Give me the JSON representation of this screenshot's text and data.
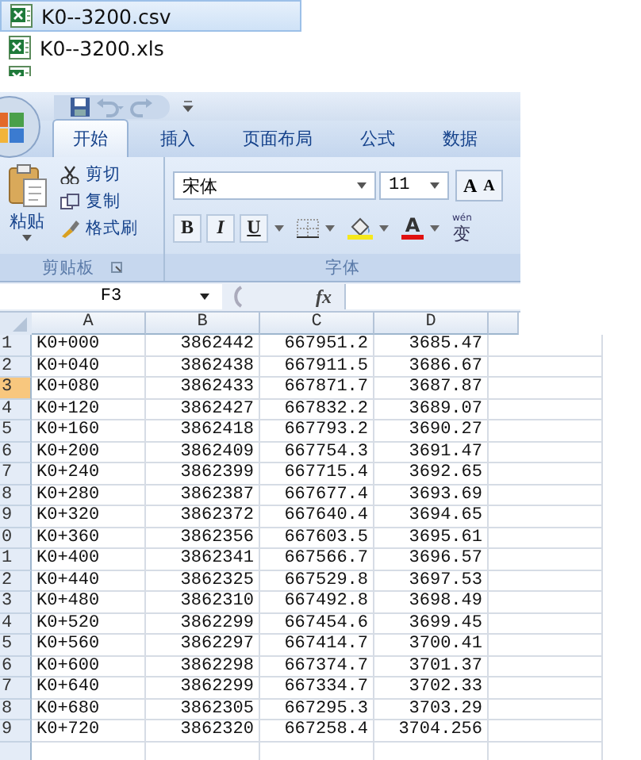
{
  "files": [
    {
      "name": "K0--3200.csv",
      "selected": true
    },
    {
      "name": "K0--3200.xls",
      "selected": false
    }
  ],
  "tabs": [
    {
      "label": "开始",
      "selected": true
    },
    {
      "label": "插入",
      "selected": false
    },
    {
      "label": "页面布局",
      "selected": false
    },
    {
      "label": "公式",
      "selected": false
    },
    {
      "label": "数据",
      "selected": false
    }
  ],
  "clipboard": {
    "paste": "粘贴",
    "items": [
      {
        "kind": "cut",
        "label": "剪切"
      },
      {
        "kind": "copy",
        "label": "复制"
      },
      {
        "kind": "painter",
        "label": "格式刷"
      }
    ],
    "label": "剪贴板"
  },
  "font": {
    "name": "宋体",
    "size": "11",
    "grow": "A",
    "shrink": "A",
    "bold": "B",
    "italic": "I",
    "underline": "U",
    "font_color_letter": "A",
    "phonetic_pinyin": "wén",
    "phonetic_char": "变",
    "label": "字体"
  },
  "formula_bar": {
    "name_box": "F3",
    "fx": "fx"
  },
  "sheet": {
    "columns": [
      "A",
      "B",
      "C",
      "D"
    ],
    "rows": [
      {
        "header": "1",
        "selected": false,
        "cells": [
          "K0+000",
          "3862442",
          "667951.2",
          "3685.47"
        ]
      },
      {
        "header": "2",
        "selected": false,
        "cells": [
          "K0+040",
          "3862438",
          "667911.5",
          "3686.67"
        ]
      },
      {
        "header": "3",
        "selected": true,
        "cells": [
          "K0+080",
          "3862433",
          "667871.7",
          "3687.87"
        ]
      },
      {
        "header": "4",
        "selected": false,
        "cells": [
          "K0+120",
          "3862427",
          "667832.2",
          "3689.07"
        ]
      },
      {
        "header": "5",
        "selected": false,
        "cells": [
          "K0+160",
          "3862418",
          "667793.2",
          "3690.27"
        ]
      },
      {
        "header": "6",
        "selected": false,
        "cells": [
          "K0+200",
          "3862409",
          "667754.3",
          "3691.47"
        ]
      },
      {
        "header": "7",
        "selected": false,
        "cells": [
          "K0+240",
          "3862399",
          "667715.4",
          "3692.65"
        ]
      },
      {
        "header": "8",
        "selected": false,
        "cells": [
          "K0+280",
          "3862387",
          "667677.4",
          "3693.69"
        ]
      },
      {
        "header": "9",
        "selected": false,
        "cells": [
          "K0+320",
          "3862372",
          "667640.4",
          "3694.65"
        ]
      },
      {
        "header": "0",
        "selected": false,
        "cells": [
          "K0+360",
          "3862356",
          "667603.5",
          "3695.61"
        ]
      },
      {
        "header": "1",
        "selected": false,
        "cells": [
          "K0+400",
          "3862341",
          "667566.7",
          "3696.57"
        ]
      },
      {
        "header": "2",
        "selected": false,
        "cells": [
          "K0+440",
          "3862325",
          "667529.8",
          "3697.53"
        ]
      },
      {
        "header": "3",
        "selected": false,
        "cells": [
          "K0+480",
          "3862310",
          "667492.8",
          "3698.49"
        ]
      },
      {
        "header": "4",
        "selected": false,
        "cells": [
          "K0+520",
          "3862299",
          "667454.6",
          "3699.45"
        ]
      },
      {
        "header": "5",
        "selected": false,
        "cells": [
          "K0+560",
          "3862297",
          "667414.7",
          "3700.41"
        ]
      },
      {
        "header": "6",
        "selected": false,
        "cells": [
          "K0+600",
          "3862298",
          "667374.7",
          "3701.37"
        ]
      },
      {
        "header": "7",
        "selected": false,
        "cells": [
          "K0+640",
          "3862299",
          "667334.7",
          "3702.33"
        ]
      },
      {
        "header": "8",
        "selected": false,
        "cells": [
          "K0+680",
          "3862305",
          "667295.3",
          "3703.29"
        ]
      },
      {
        "header": "9",
        "selected": false,
        "cells": [
          "K0+720",
          "3862320",
          "667258.4",
          "3704.256"
        ]
      }
    ]
  }
}
